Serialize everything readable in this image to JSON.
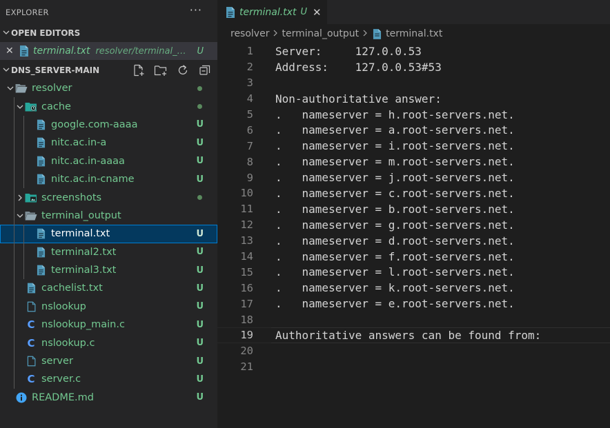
{
  "explorer": {
    "title": "EXPLORER",
    "more": "···"
  },
  "open_editors": {
    "title": "OPEN EDITORS",
    "items": [
      {
        "close": "✕",
        "name": "terminal.txt",
        "path": "resolver/terminal_output",
        "badge": "U"
      }
    ]
  },
  "workspace": {
    "title": "DNS_SERVER-MAIN",
    "actions": [
      "new-file-icon",
      "new-folder-icon",
      "refresh-icon",
      "collapse-all-icon"
    ],
    "tree": [
      {
        "label": "resolver",
        "kind": "folder-open",
        "depth": 0,
        "decoration": "dot"
      },
      {
        "label": "cache",
        "kind": "folder-cache",
        "depth": 1,
        "decoration": "dot"
      },
      {
        "label": "google.com-aaaa",
        "kind": "file",
        "depth": 2,
        "decoration": "U"
      },
      {
        "label": "nitc.ac.in-a",
        "kind": "file",
        "depth": 2,
        "decoration": "U"
      },
      {
        "label": "nitc.ac.in-aaaa",
        "kind": "file",
        "depth": 2,
        "decoration": "U"
      },
      {
        "label": "nitc.ac.in-cname",
        "kind": "file",
        "depth": 2,
        "decoration": "U"
      },
      {
        "label": "screenshots",
        "kind": "folder-images",
        "depth": 1,
        "decoration": "dot"
      },
      {
        "label": "terminal_output",
        "kind": "folder-open",
        "depth": 1,
        "decoration": ""
      },
      {
        "label": "terminal.txt",
        "kind": "file",
        "depth": 2,
        "decoration": "U",
        "selected": true
      },
      {
        "label": "terminal2.txt",
        "kind": "file",
        "depth": 2,
        "decoration": "U"
      },
      {
        "label": "terminal3.txt",
        "kind": "file",
        "depth": 2,
        "decoration": "U"
      },
      {
        "label": "cachelist.txt",
        "kind": "file",
        "depth": 1,
        "decoration": "U"
      },
      {
        "label": "nslookup",
        "kind": "file-plain",
        "depth": 1,
        "decoration": "U"
      },
      {
        "label": "nslookup_main.c",
        "kind": "c-file",
        "depth": 1,
        "decoration": "U"
      },
      {
        "label": "nslookup.c",
        "kind": "c-file",
        "depth": 1,
        "decoration": "U"
      },
      {
        "label": "server",
        "kind": "file-plain",
        "depth": 1,
        "decoration": "U"
      },
      {
        "label": "server.c",
        "kind": "c-file",
        "depth": 1,
        "decoration": "U"
      },
      {
        "label": "README.md",
        "kind": "info-file",
        "depth": 0,
        "decoration": "U"
      }
    ]
  },
  "editor": {
    "tab": {
      "name": "terminal.txt",
      "badge": "U",
      "close": "✕"
    },
    "breadcrumbs": [
      "resolver",
      "terminal_output",
      "terminal.txt"
    ],
    "current_line": 19,
    "lines": [
      "Server:     127.0.0.53",
      "Address:    127.0.0.53#53",
      "",
      "Non-authoritative answer:",
      ".   nameserver = h.root-servers.net.",
      ".   nameserver = a.root-servers.net.",
      ".   nameserver = i.root-servers.net.",
      ".   nameserver = m.root-servers.net.",
      ".   nameserver = j.root-servers.net.",
      ".   nameserver = c.root-servers.net.",
      ".   nameserver = b.root-servers.net.",
      ".   nameserver = g.root-servers.net.",
      ".   nameserver = d.root-servers.net.",
      ".   nameserver = f.root-servers.net.",
      ".   nameserver = l.root-servers.net.",
      ".   nameserver = k.root-servers.net.",
      ".   nameserver = e.root-servers.net.",
      "",
      "Authoritative answers can be found from:",
      "",
      ""
    ]
  },
  "colors": {
    "untracked": "#73c991",
    "selection": "#04395e",
    "file_icon": "#519aba",
    "c_icon": "#599eff",
    "folder": "#90a4ae",
    "cache_folder": "#26a69a"
  }
}
